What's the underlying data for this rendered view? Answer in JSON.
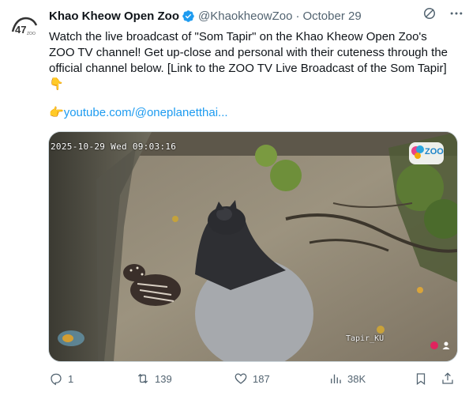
{
  "post": {
    "display_name": "Khao Kheow Open Zoo",
    "handle": "@KhaokheowZoo",
    "separator": "·",
    "date": "October 29",
    "text": "Watch the live broadcast of \"Som Tapir\" on the Khao Kheow Open Zoo's ZOO TV channel! Get up-close and personal with their cuteness through the official channel below. [Link to the ZOO TV Live Broadcast of the Som Tapir]👇",
    "link_prefix": "👉",
    "link_text": "youtube.com/@oneplanetthai...",
    "media": {
      "timestamp": "2025-10-29 Wed 09:03:16",
      "caption": "Tapir_KU",
      "logo_text": "ZOO"
    }
  },
  "actions": {
    "replies": "1",
    "reposts": "139",
    "likes": "187",
    "views": "38K"
  },
  "colors": {
    "verified": "#1d9bf0",
    "link": "#1d9bf0",
    "muted": "#536471"
  }
}
